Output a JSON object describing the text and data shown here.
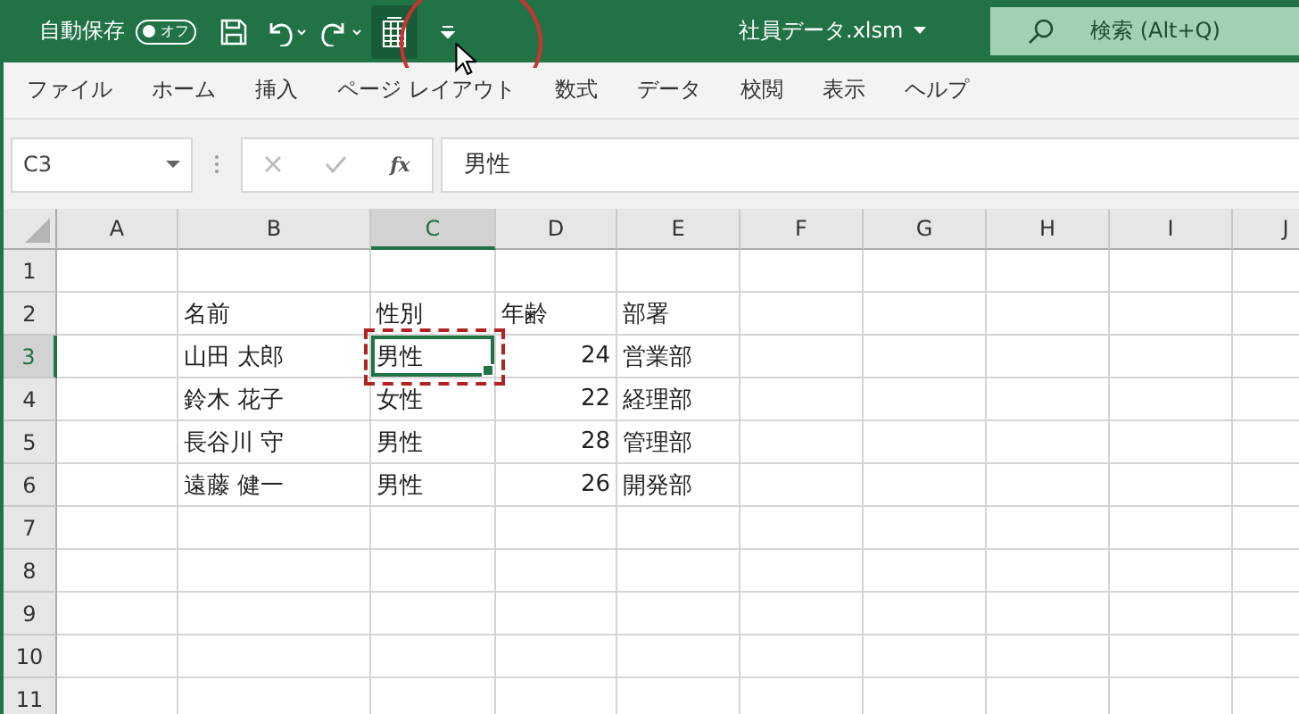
{
  "title_bar": {
    "autosave_label": "自動保存",
    "autosave_toggle": {
      "label": "オフ",
      "on": false
    },
    "quick_access": [
      {
        "kind": "save",
        "hovered": false
      },
      {
        "kind": "undo",
        "hovered": false
      },
      {
        "kind": "redo",
        "hovered": false
      },
      {
        "kind": "form",
        "hovered": true
      },
      {
        "kind": "customize",
        "hovered": false
      }
    ],
    "file_name": "社員データ.xlsm",
    "search": {
      "placeholder": "検索 (Alt+Q)"
    }
  },
  "ribbon_tabs": [
    {
      "label": "ファイル",
      "selected": false
    },
    {
      "label": "ホーム",
      "selected": false
    },
    {
      "label": "挿入",
      "selected": false
    },
    {
      "label": "ページ レイアウト",
      "selected": false
    },
    {
      "label": "数式",
      "selected": false
    },
    {
      "label": "データ",
      "selected": false
    },
    {
      "label": "校閲",
      "selected": false
    },
    {
      "label": "表示",
      "selected": false
    },
    {
      "label": "ヘルプ",
      "selected": false
    }
  ],
  "formula_bar": {
    "name_box": "C3",
    "function_label": "fx",
    "formula": "男性"
  },
  "columns": [
    {
      "label": "A",
      "selected": false
    },
    {
      "label": "B",
      "selected": false
    },
    {
      "label": "C",
      "selected": true
    },
    {
      "label": "D",
      "selected": false
    },
    {
      "label": "E",
      "selected": false
    },
    {
      "label": "F",
      "selected": false
    },
    {
      "label": "G",
      "selected": false
    },
    {
      "label": "H",
      "selected": false
    },
    {
      "label": "I",
      "selected": false
    },
    {
      "label": "J",
      "selected": false
    }
  ],
  "rows": [
    {
      "label": "1",
      "selected": false
    },
    {
      "label": "2",
      "selected": false,
      "cells": [
        {
          "text": "名前",
          "kind": "text",
          "active": false
        },
        {
          "text": "性別",
          "kind": "text",
          "active": false
        },
        {
          "text": "年齢",
          "kind": "text",
          "active": false
        },
        {
          "text": "部署",
          "kind": "text",
          "active": false
        }
      ]
    },
    {
      "label": "3",
      "selected": true,
      "cells": [
        {
          "text": "山田 太郎",
          "kind": "text",
          "active": false
        },
        {
          "text": "男性",
          "kind": "text",
          "active": true
        },
        {
          "text": "24",
          "kind": "number",
          "active": false
        },
        {
          "text": "営業部",
          "kind": "text",
          "active": false
        }
      ]
    },
    {
      "label": "4",
      "selected": false,
      "cells": [
        {
          "text": "鈴木 花子",
          "kind": "text",
          "active": false
        },
        {
          "text": "女性",
          "kind": "text",
          "active": false
        },
        {
          "text": "22",
          "kind": "number",
          "active": false
        },
        {
          "text": "経理部",
          "kind": "text",
          "active": false
        }
      ]
    },
    {
      "label": "5",
      "selected": false,
      "cells": [
        {
          "text": "長谷川 守",
          "kind": "text",
          "active": false
        },
        {
          "text": "男性",
          "kind": "text",
          "active": false
        },
        {
          "text": "28",
          "kind": "number",
          "active": false
        },
        {
          "text": "管理部",
          "kind": "text",
          "active": false
        }
      ]
    },
    {
      "label": "6",
      "selected": false,
      "cells": [
        {
          "text": "遠藤 健一",
          "kind": "text",
          "active": false
        },
        {
          "text": "男性",
          "kind": "text",
          "active": false
        },
        {
          "text": "26",
          "kind": "number",
          "active": false
        },
        {
          "text": "開発部",
          "kind": "text",
          "active": false
        }
      ]
    },
    {
      "label": "7",
      "selected": false
    },
    {
      "label": "8",
      "selected": false
    },
    {
      "label": "9",
      "selected": false
    },
    {
      "label": "10",
      "selected": false
    },
    {
      "label": "11",
      "selected": false
    }
  ]
}
